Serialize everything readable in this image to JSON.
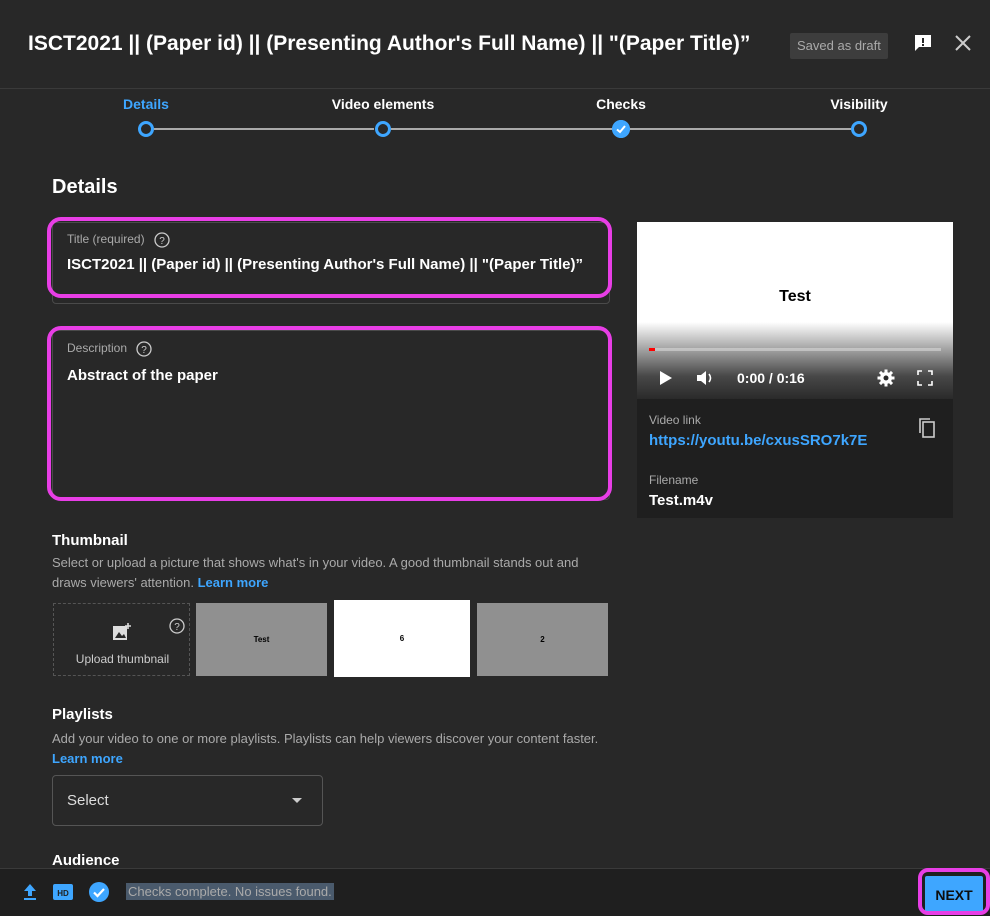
{
  "header": {
    "title": "ISCT2021 || (Paper id) || (Presenting Author's Full Name) || \"(Paper Title)”",
    "saved_badge": "Saved as draft"
  },
  "stepper": {
    "steps": [
      {
        "label": "Details",
        "state": "active"
      },
      {
        "label": "Video elements",
        "state": "pending"
      },
      {
        "label": "Checks",
        "state": "complete"
      },
      {
        "label": "Visibility",
        "state": "pending"
      }
    ]
  },
  "details": {
    "heading": "Details",
    "title_field": {
      "label": "Title (required)",
      "value": "ISCT2021 || (Paper id) || (Presenting Author's Full Name) || \"(Paper Title)”"
    },
    "description_field": {
      "label": "Description",
      "value": "Abstract of the paper"
    }
  },
  "video_card": {
    "preview_text": "Test",
    "time": "0:00 / 0:16",
    "progress_fraction": 0.01,
    "video_link_label": "Video link",
    "video_link": "https://youtu.be/cxusSRO7k7E",
    "filename_label": "Filename",
    "filename": "Test.m4v"
  },
  "thumbnail": {
    "title": "Thumbnail",
    "description": "Select or upload a picture that shows what's in your video. A good thumbnail stands out and draws viewers' attention.",
    "learn_more": "Learn more",
    "upload_label": "Upload thumbnail",
    "options": [
      {
        "text": "Test",
        "color": "#909090"
      },
      {
        "text": "6",
        "color": "#ffffff"
      },
      {
        "text": "2",
        "color": "#909090"
      }
    ]
  },
  "playlists": {
    "title": "Playlists",
    "description": "Add your video to one or more playlists. Playlists can help viewers discover your content faster.",
    "learn_more": "Learn more",
    "select_value": "Select"
  },
  "audience": {
    "title": "Audience"
  },
  "footer": {
    "status": "Checks complete. No issues found.",
    "next_label": "NEXT"
  },
  "colors": {
    "accent": "#3ea6ff",
    "highlight": "#e83ee6",
    "background": "#282828"
  }
}
